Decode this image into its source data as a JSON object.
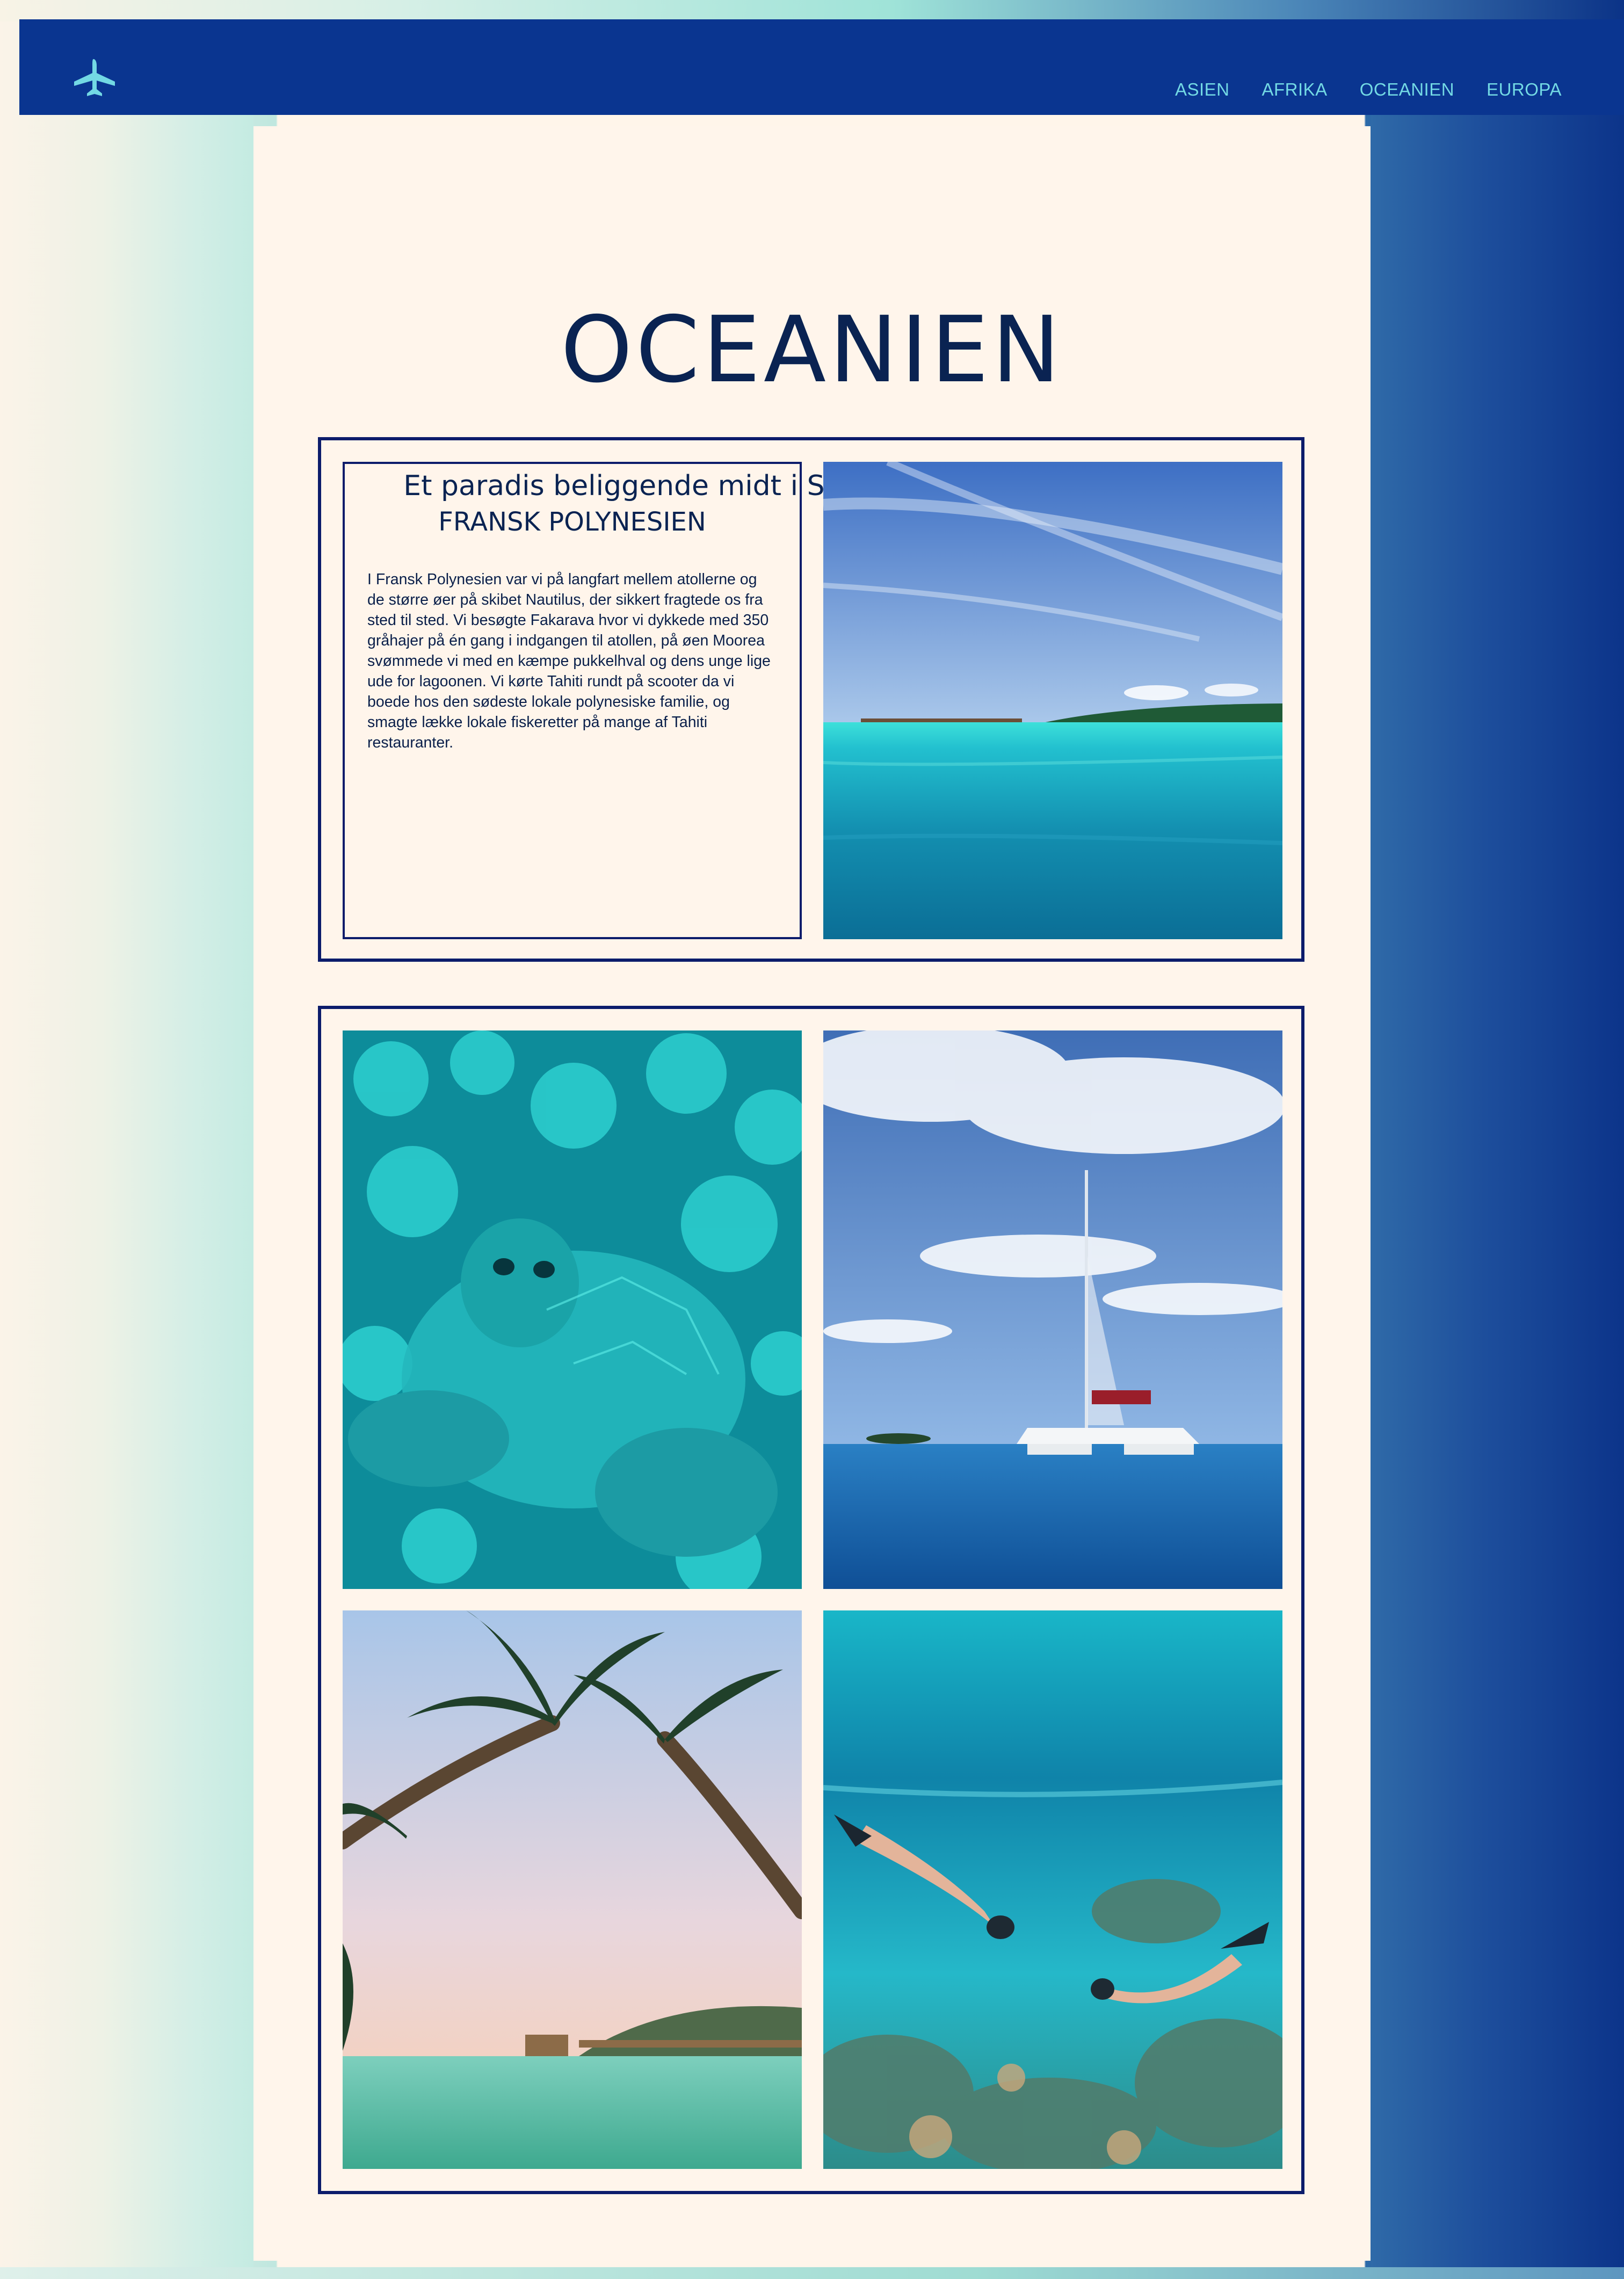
{
  "nav": {
    "logo_icon": "airplane-icon",
    "links": [
      "ASIEN",
      "AFRIKA",
      "OCEANIEN",
      "EUROPA"
    ]
  },
  "page": {
    "title": "OCEANIEN",
    "subtitle": "Et paradis beliggende midt i Stillehavets krystalklare vand"
  },
  "section": {
    "heading": "FRANSK POLYNESIEN",
    "body": "I Fransk Polynesien var vi på langfart mellem atollerne og de større øer på skibet Nautilus, der sikkert fragtede os fra sted til sted. Vi besøgte Fakarava hvor vi dykkede med 350 gråhajer på én gang i indgangen til atollen, på øen Moorea svømmede vi med en kæmpe pukkelhval og dens unge lige ude for lagoonen. Vi kørte Tahiti rundt på scooter da vi boede hos den sødeste lokale polynesiske familie, og smagte lække lokale fiskeretter på mange af Tahiti restauranter."
  },
  "colors": {
    "navbar": "#0a3590",
    "nav_link": "#73d9e4",
    "text": "#0a2352",
    "border": "#0c1c6b",
    "page_bg": "#fff5eb"
  }
}
